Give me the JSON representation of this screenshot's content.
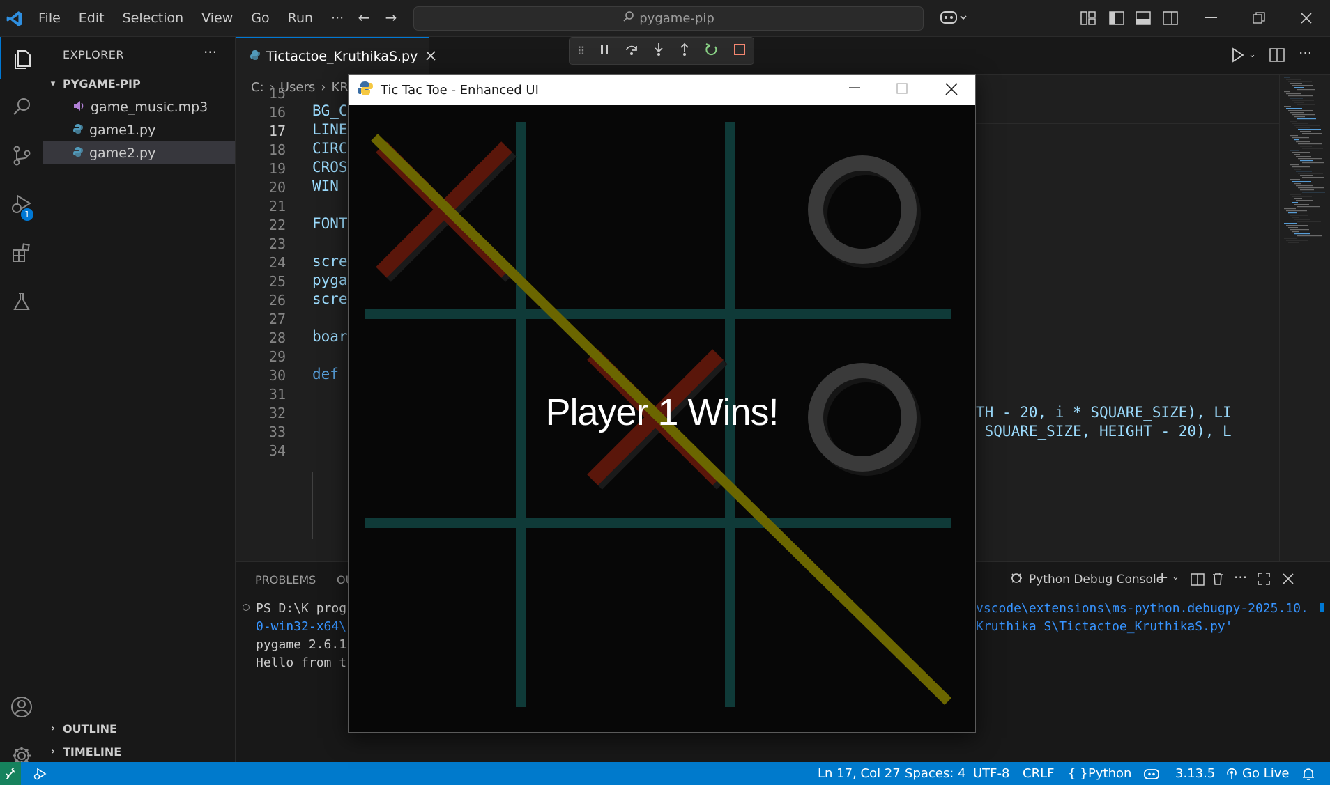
{
  "menu": [
    "File",
    "Edit",
    "Selection",
    "View",
    "Go",
    "Run"
  ],
  "command_center": "pygame-pip",
  "explorer": {
    "title": "EXPLORER",
    "folder": "PYGAME-PIP",
    "files": [
      {
        "name": "game_music.mp3",
        "icon": "audio-file-icon"
      },
      {
        "name": "game1.py",
        "icon": "python-file-icon"
      },
      {
        "name": "game2.py",
        "icon": "python-file-icon"
      }
    ],
    "outline": "OUTLINE",
    "timeline": "TIMELINE"
  },
  "debug_badge": "1",
  "tab": {
    "label": "Tictactoe_KruthikaS.py"
  },
  "breadcrumb": [
    "C:",
    "Users",
    "KR"
  ],
  "editor": {
    "lines": [
      {
        "n": "15",
        "code": ""
      },
      {
        "n": "16",
        "code": "BG_C"
      },
      {
        "n": "17",
        "code": "LINE"
      },
      {
        "n": "18",
        "code": "CIRC"
      },
      {
        "n": "19",
        "code": "CROS"
      },
      {
        "n": "20",
        "code": "WIN_"
      },
      {
        "n": "21",
        "code": ""
      },
      {
        "n": "22",
        "code": "FONT"
      },
      {
        "n": "23",
        "code": ""
      },
      {
        "n": "24",
        "code": "scre"
      },
      {
        "n": "25",
        "code": "pyga"
      },
      {
        "n": "26",
        "code": "scre"
      },
      {
        "n": "27",
        "code": ""
      },
      {
        "n": "28",
        "code": "boar"
      },
      {
        "n": "29",
        "code": ""
      },
      {
        "n": "30",
        "code": "def "
      },
      {
        "n": "31",
        "code": ""
      },
      {
        "n": "32",
        "code": ""
      },
      {
        "n": "33",
        "code": ""
      },
      {
        "n": "34",
        "code": ""
      }
    ],
    "right_line_32": "TH - 20, i * SQUARE_SIZE), LI",
    "right_line_33": " SQUARE_SIZE, HEIGHT - 20), L"
  },
  "panel": {
    "tabs": [
      "PROBLEMS",
      "OU"
    ],
    "console_name": "Python Debug Console",
    "terminal_left": [
      "PS D:\\K prog",
      "0-win32-x64\\",
      "pygame 2.6.1",
      "Hello from t"
    ],
    "terminal_right": [
      "vscode\\extensions\\ms-python.debugpy-2025.10.",
      "Kruthika S\\Tictactoe_KruthikaS.py'"
    ]
  },
  "statusbar": {
    "position": "Ln 17, Col 27",
    "spaces": "Spaces: 4",
    "encoding": "UTF-8",
    "eol": "CRLF",
    "language": "Python",
    "version": "3.13.5",
    "golive": "Go Live"
  },
  "game": {
    "window_title": "Tic Tac Toe - Enhanced UI",
    "message": "Player 1 Wins!",
    "board": [
      [
        "X",
        "",
        "O"
      ],
      [
        "",
        "X",
        "O"
      ],
      [
        "",
        "",
        ""
      ]
    ],
    "colors": {
      "grid": "#0f3a38",
      "cross": "#5a160a",
      "circle": "#3a3a3a",
      "win_line": "#6b6600",
      "message": "#ffffff"
    }
  },
  "colors": {
    "accent": "#0078d4",
    "statusbar": "#007acc",
    "badge": "#0078d4"
  }
}
